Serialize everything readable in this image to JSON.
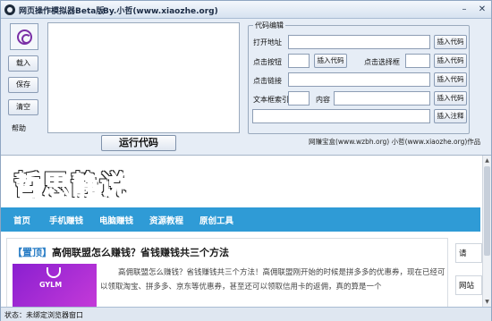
{
  "window": {
    "title": "网页操作模拟器Beta版",
    "subtitle": "By.小哲(www.xiaozhe.org)"
  },
  "left_panel": {
    "load_label": "载入",
    "save_label": "保存",
    "clear_label": "清空",
    "help_label": "帮助"
  },
  "run_button": "运行代码",
  "code_editor": {
    "legend": "代码编辑",
    "open_url_label": "打开地址",
    "click_button_label": "点击按钮",
    "click_select_label": "点击选择框",
    "click_link_label": "点击链接",
    "text_index_label": "文本框索引",
    "content_label": "内容",
    "insert_code_label": "插入代码",
    "insert_comment_label": "插入注释",
    "open_url_value": "",
    "click_button_value": "",
    "click_select_value": "",
    "click_link_value": "",
    "text_index_value": "",
    "content_value": "",
    "comment_value": ""
  },
  "credits": "网赚宝盒(www.wzbh.org) 小哲(www.xiaozhe.org)作品",
  "site": {
    "logo": "哲思静说",
    "nav": [
      "首页",
      "手机赚钱",
      "电脑赚钱",
      "资源教程",
      "原创工具"
    ],
    "article": {
      "tag": "【置顶】",
      "title": "高佣联盟怎么赚钱？省钱赚钱共三个方法",
      "thumb_text": "GYLM",
      "body": "高佣联盟怎么赚钱？省钱赚钱共三个方法！高佣联盟刚开始的时候是拼多多的优惠券，现在已经可以领取淘宝、拼多多、京东等优惠券，甚至还可以领取信用卡的返佣，真的算是一个"
    },
    "right_col": [
      "请",
      "网站"
    ]
  },
  "status": "状态：未绑定浏览器窗口",
  "colors": {
    "nav_bg": "#2f9bd6",
    "tag": "#2a7ec6",
    "thumb": "#8a1fd0"
  }
}
